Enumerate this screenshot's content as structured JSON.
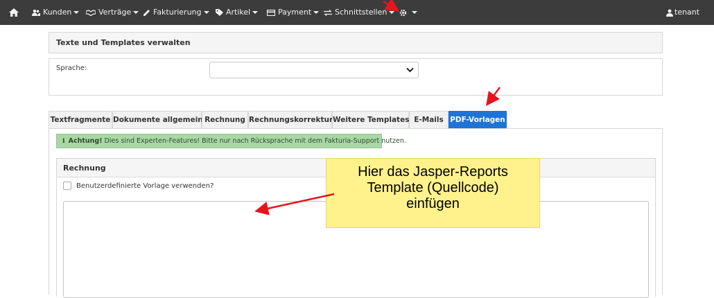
{
  "nav": {
    "items": [
      {
        "label": "Kunden",
        "icon": "users-icon"
      },
      {
        "label": "Verträge",
        "icon": "handshake-icon"
      },
      {
        "label": "Fakturierung",
        "icon": "pen-icon"
      },
      {
        "label": "Artikel",
        "icon": "tag-icon"
      },
      {
        "label": "Payment",
        "icon": "credit-card-icon"
      },
      {
        "label": "Schnittstellen",
        "icon": "exchange-icon"
      }
    ],
    "user": "tenant"
  },
  "page": {
    "title": "Texte und Templates verwalten",
    "language_label": "Sprache:",
    "language_value": ""
  },
  "tabs": [
    "Textfragmente",
    "Dokumente allgemein",
    "Rechnung",
    "Rechnungskorrektur",
    "Weitere Templates",
    "E-Mails",
    "PDF-Vorlagen"
  ],
  "active_tab": "PDF-Vorlagen",
  "alert": {
    "bold": "Achtung!",
    "text": "Dies sind Experten-Features! Bitte nur nach Rücksprache mit dem Fakturia-Support nutzen."
  },
  "section": {
    "title": "Rechnung",
    "checkbox_label": "Benutzerdefinierte Vorlage verwenden?",
    "checked": false,
    "template_value": ""
  },
  "annotation": {
    "lines": [
      "Hier das Jasper-Reports",
      "Template (Quellcode)",
      "einfügen"
    ]
  },
  "colors": {
    "navbar": "#3c3c3c",
    "active_tab": "#1e73d6",
    "alert_bg": "#a9d8a6",
    "callout_bg": "#fff28c",
    "arrow": "#e8141c"
  }
}
